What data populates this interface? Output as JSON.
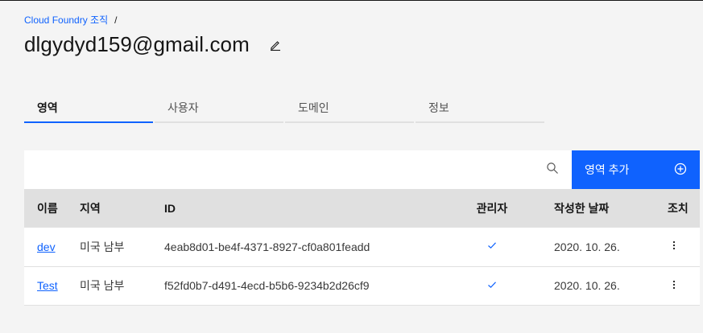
{
  "breadcrumb": {
    "link": "Cloud Foundry 조직",
    "separator": "/"
  },
  "page": {
    "title": "dlgydyd159@gmail.com"
  },
  "tabs": [
    {
      "label": "영역",
      "active": true
    },
    {
      "label": "사용자",
      "active": false
    },
    {
      "label": "도메인",
      "active": false
    },
    {
      "label": "정보",
      "active": false
    }
  ],
  "toolbar": {
    "add_label": "영역 추가"
  },
  "table": {
    "headers": {
      "name": "이름",
      "region": "지역",
      "id": "ID",
      "manager": "관리자",
      "created": "작성한 날짜",
      "action": "조치"
    },
    "rows": [
      {
        "name": "dev",
        "region": "미국 남부",
        "id": "4eab8d01-be4f-4371-8927-cf0a801feadd",
        "manager": true,
        "created": "2020. 10. 26."
      },
      {
        "name": "Test",
        "region": "미국 남부",
        "id": "f52fd0b7-d491-4ecd-b5b6-9234b2d26cf9",
        "manager": true,
        "created": "2020. 10. 26."
      }
    ]
  },
  "icons": {
    "edit": "edit-icon",
    "search": "search-icon",
    "add": "add-circle-icon",
    "check": "checkmark-icon",
    "overflow": "overflow-menu-icon"
  },
  "colors": {
    "accent": "#0f62fe",
    "background": "#f4f4f4",
    "header": "#e0e0e0"
  }
}
